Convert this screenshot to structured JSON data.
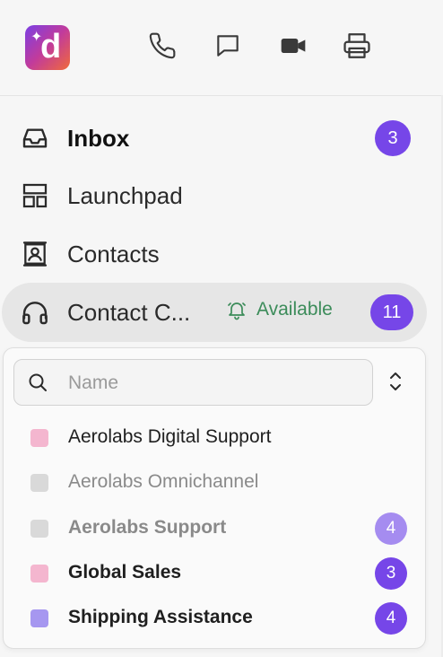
{
  "app": {
    "logo_letter": "d"
  },
  "toolbar": {
    "icons": [
      "phone-icon",
      "chat-icon",
      "video-icon",
      "print-icon"
    ]
  },
  "nav": {
    "inbox": {
      "label": "Inbox",
      "badge": "3",
      "icon": "inbox-icon"
    },
    "launchpad": {
      "label": "Launchpad",
      "icon": "layout-icon"
    },
    "contacts": {
      "label": "Contacts",
      "icon": "contact-card-icon"
    },
    "contact_center": {
      "label": "Contact C...",
      "status": "Available",
      "badge": "11",
      "icon": "headset-icon"
    }
  },
  "dropdown": {
    "search_placeholder": "Name",
    "teams": [
      {
        "name": "Aerolabs Digital Support",
        "color": "#f4b6cf",
        "bold": false,
        "muted": false,
        "count": ""
      },
      {
        "name": "Aerolabs Omnichannel",
        "color": "#d9d9d9",
        "bold": false,
        "muted": true,
        "count": ""
      },
      {
        "name": "Aerolabs Support",
        "color": "#d9d9d9",
        "bold": true,
        "muted": true,
        "count": "4"
      },
      {
        "name": "Global Sales",
        "color": "#f4b6cf",
        "bold": true,
        "muted": false,
        "count": "3"
      },
      {
        "name": "Shipping Assistance",
        "color": "#a697f0",
        "bold": true,
        "muted": false,
        "count": "4"
      }
    ]
  },
  "colors": {
    "accent": "#7646e8",
    "accent_muted": "#a58cf0",
    "available_green": "#3c8c5a"
  }
}
